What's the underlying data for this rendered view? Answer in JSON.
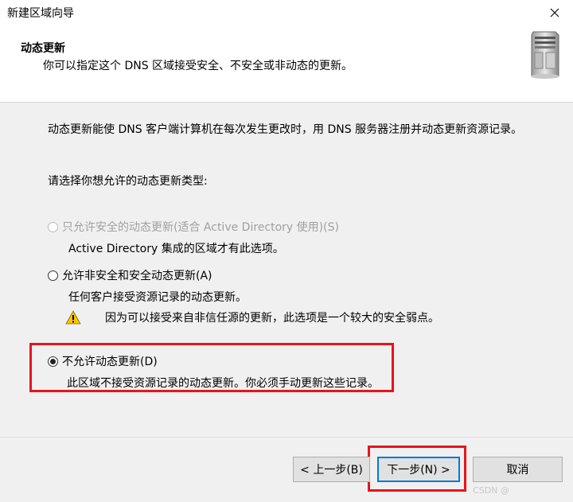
{
  "window": {
    "title": "新建区域向导",
    "close_icon": "close-icon"
  },
  "header": {
    "title": "动态更新",
    "subtitle": "你可以指定这个 DNS 区域接受安全、不安全或非动态的更新。",
    "icon": "server-icon"
  },
  "content": {
    "description": "动态更新能使 DNS 客户端计算机在每次发生更改时，用 DNS 服务器注册并动态更新资源记录。",
    "prompt": "请选择你想允许的动态更新类型:",
    "options": [
      {
        "label": "只允许安全的动态更新(适合 Active Directory 使用)(S)",
        "description": "Active Directory 集成的区域才有此选项。",
        "checked": false,
        "enabled": false
      },
      {
        "label": "允许非安全和安全动态更新(A)",
        "description": "任何客户接受资源记录的动态更新。",
        "checked": false,
        "enabled": true
      },
      {
        "label": "不允许动态更新(D)",
        "description": "此区域不接受资源记录的动态更新。你必须手动更新这些记录。",
        "checked": true,
        "enabled": true
      }
    ],
    "warning": {
      "icon": "warning-icon",
      "text": "因为可以接受来自非信任源的更新，此选项是一个较大的安全弱点。"
    }
  },
  "footer": {
    "back_label": "< 上一步(B)",
    "next_label": "下一步(N) >",
    "cancel_label": "取消",
    "watermark": "CSDN @"
  },
  "colors": {
    "highlight": "#e8141b",
    "default_button_border": "#0078d7"
  }
}
